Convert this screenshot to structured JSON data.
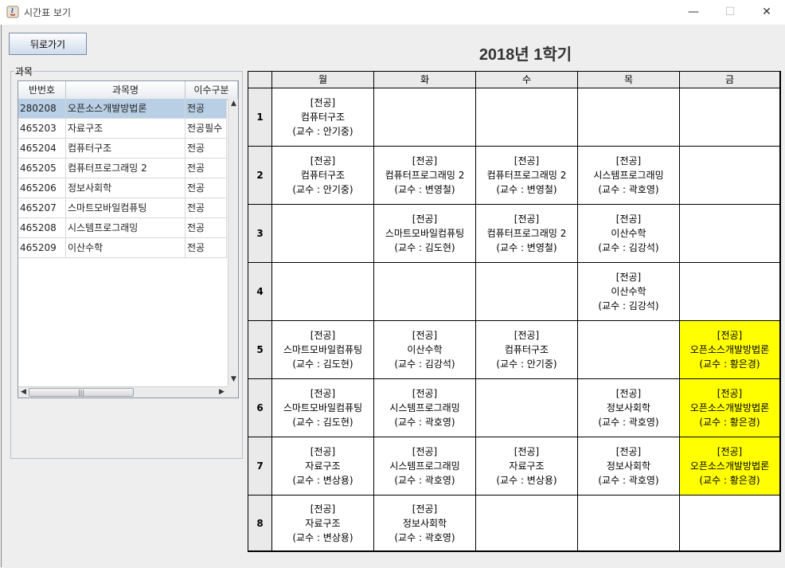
{
  "window": {
    "title": "시간표 보기",
    "controls": {
      "minimize": "—",
      "maximize": "☐",
      "close": "✕"
    }
  },
  "back_button": "뒤로가기",
  "semester_title": "2018년 1학기",
  "course_panel": {
    "label": "과목",
    "columns": [
      "반번호",
      "과목명",
      "이수구분"
    ],
    "rows": [
      [
        "280208",
        "오픈소스개발방법론",
        "전공"
      ],
      [
        "465203",
        "자료구조",
        "전공필수"
      ],
      [
        "465204",
        "컴퓨터구조",
        "전공"
      ],
      [
        "465205",
        "컴퓨터프로그래밍 2",
        "전공"
      ],
      [
        "465206",
        "정보사회학",
        "전공"
      ],
      [
        "465207",
        "스마트모바일컴퓨팅",
        "전공"
      ],
      [
        "465208",
        "시스템프로그래밍",
        "전공"
      ],
      [
        "465209",
        "이산수학",
        "전공"
      ]
    ],
    "selected_row": 0
  },
  "timetable": {
    "days": [
      "월",
      "화",
      "수",
      "목",
      "금"
    ],
    "periods": [
      "1",
      "2",
      "3",
      "4",
      "5",
      "6",
      "7",
      "8"
    ],
    "highlight_color": "#ffff00",
    "cells": [
      [
        {
          "type": "[전공]",
          "name": "컴퓨터구조",
          "prof": "(교수 : 안기중)"
        },
        {
          "type": "",
          "name": "",
          "prof": ""
        },
        {
          "type": "",
          "name": "",
          "prof": ""
        },
        {
          "type": "",
          "name": "",
          "prof": ""
        },
        {
          "type": "",
          "name": "",
          "prof": ""
        }
      ],
      [
        {
          "type": "[전공]",
          "name": "컴퓨터구조",
          "prof": "(교수 : 안기중)"
        },
        {
          "type": "[전공]",
          "name": "컴퓨터프로그래밍 2",
          "prof": "(교수 : 변영철)"
        },
        {
          "type": "[전공]",
          "name": "컴퓨터프로그래밍 2",
          "prof": "(교수 : 변영철)"
        },
        {
          "type": "[전공]",
          "name": "시스템프로그래밍",
          "prof": "(교수 : 곽호영)"
        },
        {
          "type": "",
          "name": "",
          "prof": ""
        }
      ],
      [
        {
          "type": "",
          "name": "",
          "prof": ""
        },
        {
          "type": "[전공]",
          "name": "스마트모바일컴퓨팅",
          "prof": "(교수 : 김도현)"
        },
        {
          "type": "[전공]",
          "name": "컴퓨터프로그래밍 2",
          "prof": "(교수 : 변영철)"
        },
        {
          "type": "[전공]",
          "name": "이산수학",
          "prof": "(교수 : 김강석)"
        },
        {
          "type": "",
          "name": "",
          "prof": ""
        }
      ],
      [
        {
          "type": "",
          "name": "",
          "prof": ""
        },
        {
          "type": "",
          "name": "",
          "prof": ""
        },
        {
          "type": "",
          "name": "",
          "prof": ""
        },
        {
          "type": "[전공]",
          "name": "이산수학",
          "prof": "(교수 : 김강석)"
        },
        {
          "type": "",
          "name": "",
          "prof": ""
        }
      ],
      [
        {
          "type": "[전공]",
          "name": "스마트모바일컴퓨팅",
          "prof": "(교수 : 김도현)"
        },
        {
          "type": "[전공]",
          "name": "이산수학",
          "prof": "(교수 : 김강석)"
        },
        {
          "type": "[전공]",
          "name": "컴퓨터구조",
          "prof": "(교수 : 안기중)"
        },
        {
          "type": "",
          "name": "",
          "prof": ""
        },
        {
          "type": "[전공]",
          "name": "오픈소스개발방법론",
          "prof": "(교수 : 황은경)",
          "highlight": true
        }
      ],
      [
        {
          "type": "[전공]",
          "name": "스마트모바일컴퓨팅",
          "prof": "(교수 : 김도현)"
        },
        {
          "type": "[전공]",
          "name": "시스템프로그래밍",
          "prof": "(교수 : 곽호영)"
        },
        {
          "type": "",
          "name": "",
          "prof": ""
        },
        {
          "type": "[전공]",
          "name": "정보사회학",
          "prof": "(교수 : 곽호영)"
        },
        {
          "type": "[전공]",
          "name": "오픈소스개발방법론",
          "prof": "(교수 : 황은경)",
          "highlight": true
        }
      ],
      [
        {
          "type": "[전공]",
          "name": "자료구조",
          "prof": "(교수 : 변상용)"
        },
        {
          "type": "[전공]",
          "name": "시스템프로그래밍",
          "prof": "(교수 : 곽호영)"
        },
        {
          "type": "[전공]",
          "name": "자료구조",
          "prof": "(교수 : 변상용)"
        },
        {
          "type": "[전공]",
          "name": "정보사회학",
          "prof": "(교수 : 곽호영)"
        },
        {
          "type": "[전공]",
          "name": "오픈소스개발방법론",
          "prof": "(교수 : 황은경)",
          "highlight": true
        }
      ],
      [
        {
          "type": "[전공]",
          "name": "자료구조",
          "prof": "(교수 : 변상용)"
        },
        {
          "type": "[전공]",
          "name": "정보사회학",
          "prof": "(교수 : 곽호영)"
        },
        {
          "type": "",
          "name": "",
          "prof": ""
        },
        {
          "type": "",
          "name": "",
          "prof": ""
        },
        {
          "type": "",
          "name": "",
          "prof": ""
        }
      ]
    ]
  }
}
